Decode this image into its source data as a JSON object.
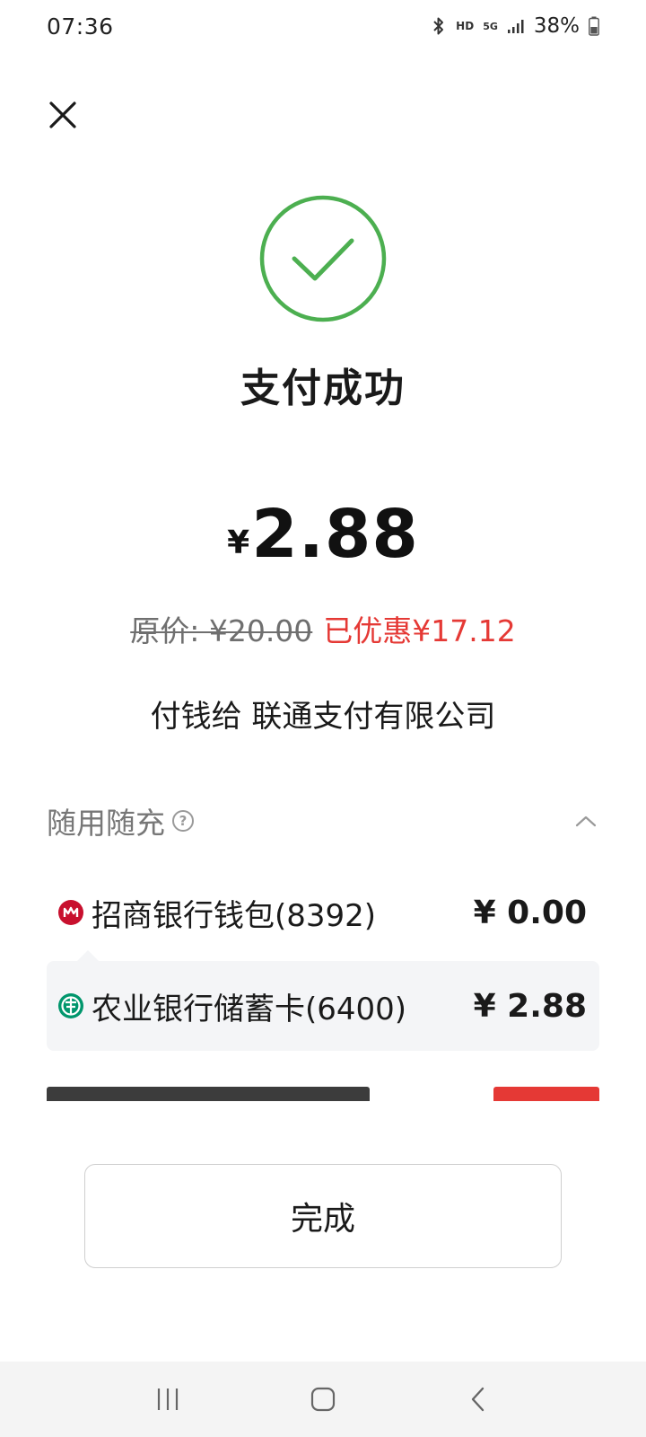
{
  "status_bar": {
    "time": "07:36",
    "icons": [
      "bluetooth-icon",
      "hd-icon",
      "5g-icon",
      "signal-icon",
      "battery-icon"
    ],
    "hd_label": "HD",
    "network_label": "5G",
    "battery_level": "38%"
  },
  "header": {
    "close_icon": "close-icon"
  },
  "result": {
    "icon": "success-check-icon",
    "title": "支付成功",
    "currency_symbol": "¥",
    "amount": "2.88",
    "original_price": "原价: ¥20.00",
    "discount": "已优惠¥17.12",
    "payee": "付钱给 联通支付有限公司",
    "accent_color": "#4caf50",
    "discount_color": "#e53935"
  },
  "payment_section": {
    "title": "随用随充",
    "help_icon": "help-circle-icon",
    "collapse_icon": "chevron-up-icon",
    "methods": [
      {
        "name": "招商银行钱包(8392)",
        "amount": "¥ 0.00",
        "icon": "cmb-bank-icon"
      },
      {
        "name": "农业银行储蓄卡(6400)",
        "amount": "¥ 2.88",
        "icon": "abc-bank-icon"
      }
    ]
  },
  "actions": {
    "done_label": "完成"
  },
  "nav_bar": {
    "icons": [
      "recent-apps-icon",
      "home-icon",
      "back-icon"
    ]
  }
}
